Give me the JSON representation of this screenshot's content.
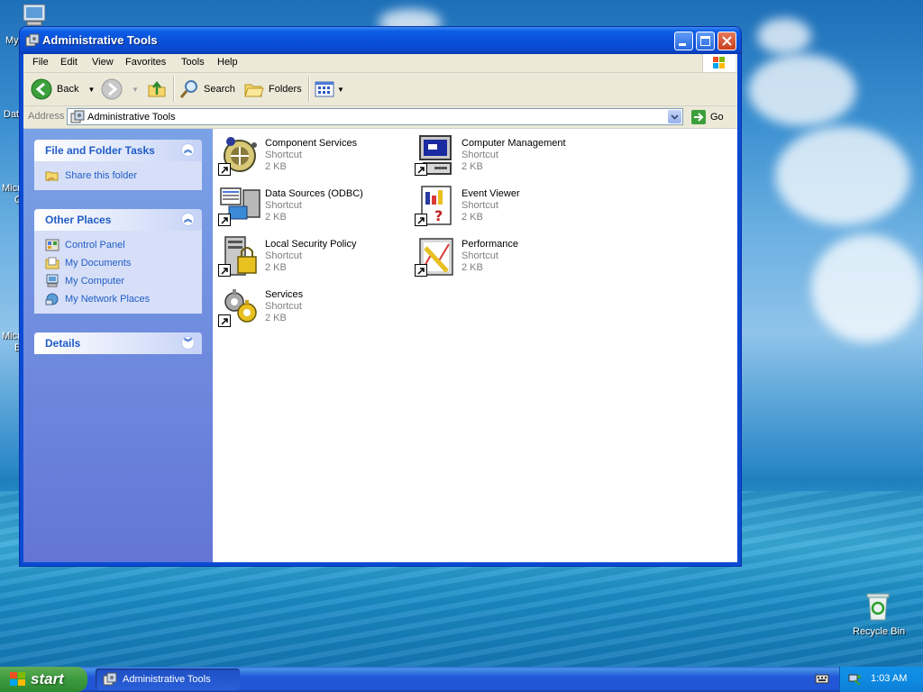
{
  "desktop": {
    "icons": [
      {
        "label": "My"
      },
      {
        "label": "Dat"
      },
      {
        "label": "Micro"
      },
      {
        "label": "C"
      },
      {
        "label": "Micro"
      },
      {
        "label": "B"
      }
    ],
    "recycle_bin": {
      "label": "Recycle Bin"
    }
  },
  "window": {
    "title": "Administrative Tools",
    "controls": {
      "minimize": "minimize",
      "maximize": "maximize",
      "close": "close"
    }
  },
  "menu": [
    "File",
    "Edit",
    "View",
    "Favorites",
    "Tools",
    "Help"
  ],
  "toolbar": {
    "back_label": "Back",
    "search_label": "Search",
    "folders_label": "Folders"
  },
  "address": {
    "label": "Address",
    "value": "Administrative Tools",
    "go_label": "Go"
  },
  "taskpane": {
    "file_tasks": {
      "title": "File and Folder Tasks",
      "items": [
        "Share this folder"
      ]
    },
    "other_places": {
      "title": "Other Places",
      "items": [
        "Control Panel",
        "My Documents",
        "My Computer",
        "My Network Places"
      ]
    },
    "details": {
      "title": "Details"
    }
  },
  "files": [
    {
      "name": "Component Services",
      "type": "Shortcut",
      "size": "2 KB",
      "icon": "component-services-icon"
    },
    {
      "name": "Computer Management",
      "type": "Shortcut",
      "size": "2 KB",
      "icon": "computer-management-icon"
    },
    {
      "name": "Data Sources (ODBC)",
      "type": "Shortcut",
      "size": "2 KB",
      "icon": "data-sources-icon"
    },
    {
      "name": "Event Viewer",
      "type": "Shortcut",
      "size": "2 KB",
      "icon": "event-viewer-icon"
    },
    {
      "name": "Local Security Policy",
      "type": "Shortcut",
      "size": "2 KB",
      "icon": "security-policy-icon"
    },
    {
      "name": "Performance",
      "type": "Shortcut",
      "size": "2 KB",
      "icon": "performance-icon"
    },
    {
      "name": "Services",
      "type": "Shortcut",
      "size": "2 KB",
      "icon": "services-icon"
    }
  ],
  "taskbar": {
    "start_label": "start",
    "task_label": "Administrative Tools",
    "clock": "1:03 AM"
  },
  "colors": {
    "title_blue": "#0a50d8",
    "taskpane_link": "#215dc6",
    "start_green": "#3c9a3d"
  }
}
